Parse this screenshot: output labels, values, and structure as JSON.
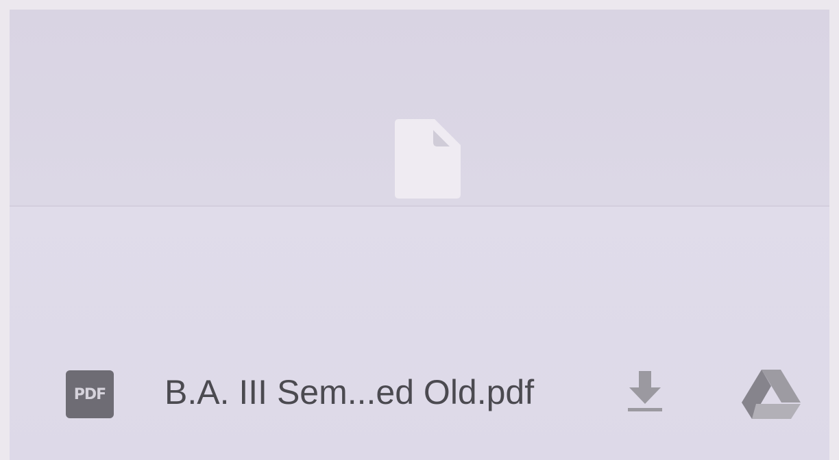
{
  "attachment": {
    "file_type_label": "PDF",
    "file_name": "B.A. III Sem...ed Old.pdf",
    "preview_icon": "file-icon",
    "actions": [
      {
        "name": "download",
        "icon": "download-icon"
      },
      {
        "name": "save-to-drive",
        "icon": "drive-icon"
      }
    ]
  },
  "colors": {
    "background": "#dcd8e6",
    "text": "#4b4a50",
    "pdf_badge": "#6e6c74",
    "icon_gray": "#9b99a0",
    "file_icon": "#efebf2"
  }
}
